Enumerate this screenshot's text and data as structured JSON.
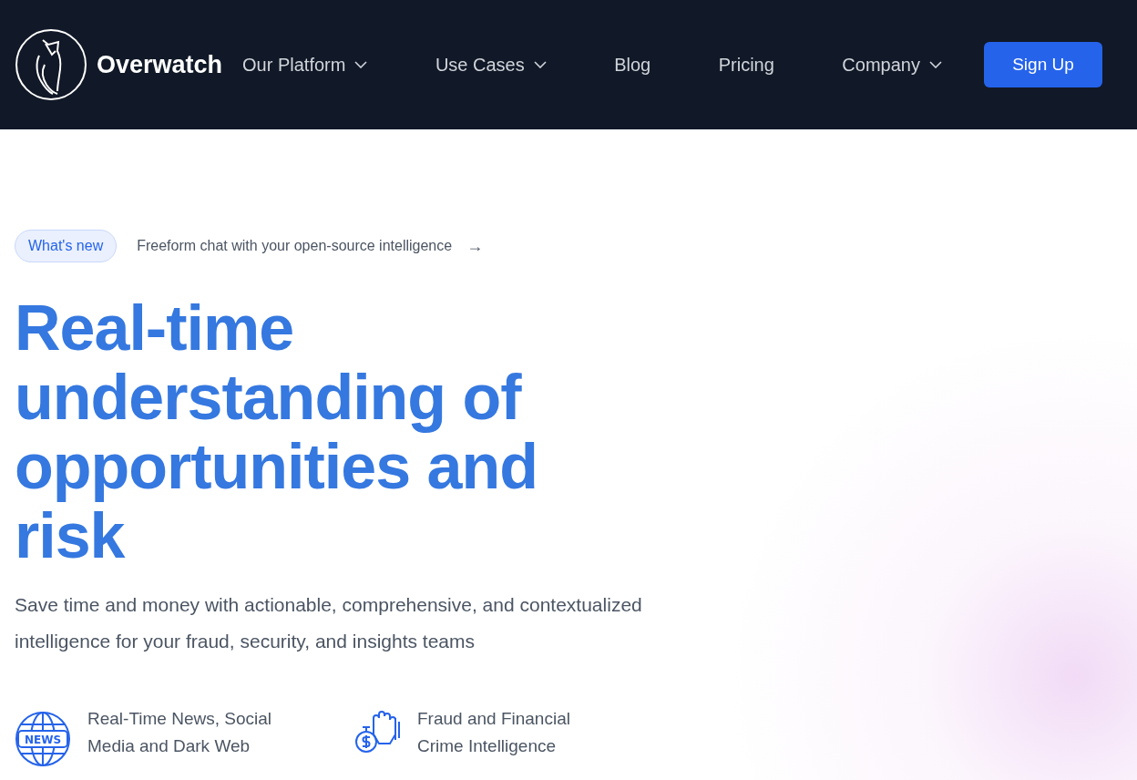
{
  "header": {
    "brand": "Overwatch",
    "nav": [
      {
        "label": "Our Platform",
        "kind": "dropdown"
      },
      {
        "label": "Use Cases",
        "kind": "dropdown"
      },
      {
        "label": "Blog",
        "kind": "link"
      },
      {
        "label": "Pricing",
        "kind": "link"
      },
      {
        "label": "Company",
        "kind": "dropdown"
      }
    ],
    "cta": "Sign Up"
  },
  "announcement": {
    "badge": "What's new",
    "text": "Freeform chat with your open-source intelligence",
    "arrow": "→"
  },
  "hero": {
    "title": "Real-time understanding of opportunities and risk",
    "subtitle": "Save time and money with actionable, comprehensive, and contextualized intelligence for your fraud, security, and insights teams"
  },
  "features": [
    {
      "kind": "news",
      "icon_label": "NEWS",
      "text": "Real-Time News, Social Media and Dark Web"
    },
    {
      "kind": "fraud",
      "text": "Fraud and Financial Crime Intelligence"
    }
  ]
}
